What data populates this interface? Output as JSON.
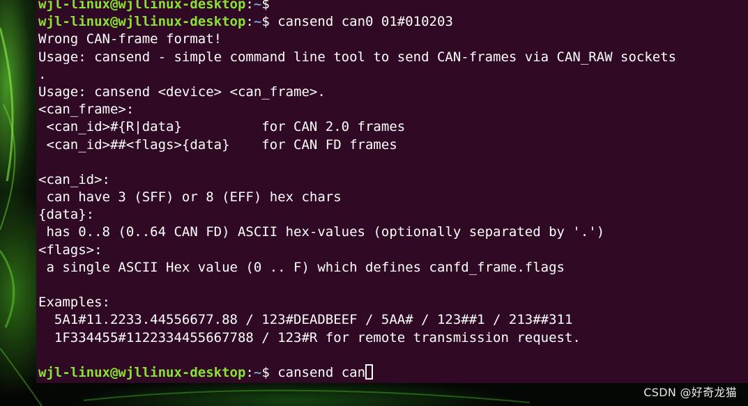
{
  "terminal": {
    "lines": [
      {
        "kind": "prompt",
        "user": "wjl-linux@wjllinux-desktop",
        "sep": ":",
        "path": "~",
        "symbol": "$",
        "command": ""
      },
      {
        "kind": "prompt",
        "user": "wjl-linux@wjllinux-desktop",
        "sep": ":",
        "path": "~",
        "symbol": "$",
        "command": " cansend can0 01#010203"
      },
      {
        "kind": "output",
        "text": "Wrong CAN-frame format!"
      },
      {
        "kind": "output",
        "text": "Usage: cansend - simple command line tool to send CAN-frames via CAN_RAW sockets"
      },
      {
        "kind": "output",
        "text": "."
      },
      {
        "kind": "output",
        "text": "Usage: cansend <device> <can_frame>."
      },
      {
        "kind": "output",
        "text": "<can_frame>:"
      },
      {
        "kind": "output",
        "text": " <can_id>#{R|data}          for CAN 2.0 frames"
      },
      {
        "kind": "output",
        "text": " <can_id>##<flags>{data}    for CAN FD frames"
      },
      {
        "kind": "output",
        "text": ""
      },
      {
        "kind": "output",
        "text": "<can_id>:"
      },
      {
        "kind": "output",
        "text": " can have 3 (SFF) or 8 (EFF) hex chars"
      },
      {
        "kind": "output",
        "text": "{data}:"
      },
      {
        "kind": "output",
        "text": " has 0..8 (0..64 CAN FD) ASCII hex-values (optionally separated by '.')"
      },
      {
        "kind": "output",
        "text": "<flags>:"
      },
      {
        "kind": "output",
        "text": " a single ASCII Hex value (0 .. F) which defines canfd_frame.flags"
      },
      {
        "kind": "output",
        "text": ""
      },
      {
        "kind": "output",
        "text": "Examples:"
      },
      {
        "kind": "output",
        "text": "  5A1#11.2233.44556677.88 / 123#DEADBEEF / 5AA# / 123##1 / 213##311"
      },
      {
        "kind": "output",
        "text": "  1F334455#1122334455667788 / 123#R for remote transmission request."
      },
      {
        "kind": "output",
        "text": ""
      },
      {
        "kind": "prompt",
        "user": "wjl-linux@wjllinux-desktop",
        "sep": ":",
        "path": "~",
        "symbol": "$",
        "command": " cansend can",
        "cursor": true
      }
    ],
    "colors": {
      "background": "#300a24",
      "text": "#ffffff",
      "prompt_user": "#8ae234",
      "prompt_path": "#729fcf"
    }
  },
  "watermark": "CSDN @好奇龙猫"
}
